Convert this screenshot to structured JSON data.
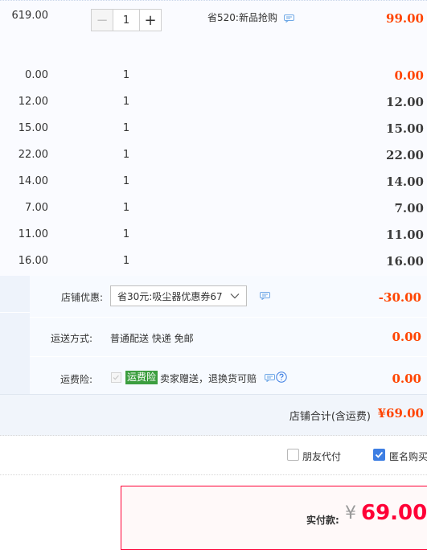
{
  "items": [
    {
      "price": "619.00",
      "quantity": "1",
      "promotion": "省520:新品抢购",
      "subtotal": "99.00",
      "highlight": true
    },
    {
      "price": "0.00",
      "quantity": "1",
      "subtotal": "0.00",
      "highlight": true
    },
    {
      "price": "12.00",
      "quantity": "1",
      "subtotal": "12.00"
    },
    {
      "price": "15.00",
      "quantity": "1",
      "subtotal": "15.00"
    },
    {
      "price": "22.00",
      "quantity": "1",
      "subtotal": "22.00"
    },
    {
      "price": "14.00",
      "quantity": "1",
      "subtotal": "14.00"
    },
    {
      "price": "7.00",
      "quantity": "1",
      "subtotal": "7.00"
    },
    {
      "price": "11.00",
      "quantity": "1",
      "subtotal": "11.00"
    },
    {
      "price": "16.00",
      "quantity": "1",
      "subtotal": "16.00"
    }
  ],
  "stepper": {
    "minus": "−",
    "plus": "+",
    "value": "1"
  },
  "shop": {
    "discount_label": "店铺优惠:",
    "discount_selected": "省30元:吸尘器优惠券67",
    "discount_value": "-30.00",
    "shipping_label": "运送方式:",
    "shipping_method": "普通配送 快递 免邮",
    "shipping_value": "0.00",
    "insurance_label": "运费险:",
    "insurance_tag": "运费险",
    "insurance_text": "卖家赠送，退换货可赔",
    "insurance_value": "0.00",
    "total_label": "店铺合计(含运费)",
    "total_value": "¥69.00"
  },
  "options": {
    "friend_pay": "朋友代付",
    "anonymous": "匿名购买"
  },
  "payment": {
    "label": "实付款:",
    "currency": "¥",
    "amount": "69.00"
  },
  "colors": {
    "accent_red": "#ff4400",
    "pay_red": "#ff0036",
    "check_blue": "#3d7ee3",
    "insurance_green": "#3c9e3f"
  },
  "icons": [
    "minus-icon",
    "plus-icon",
    "chat-icon",
    "chevron-down-icon",
    "help-icon",
    "check-icon"
  ]
}
